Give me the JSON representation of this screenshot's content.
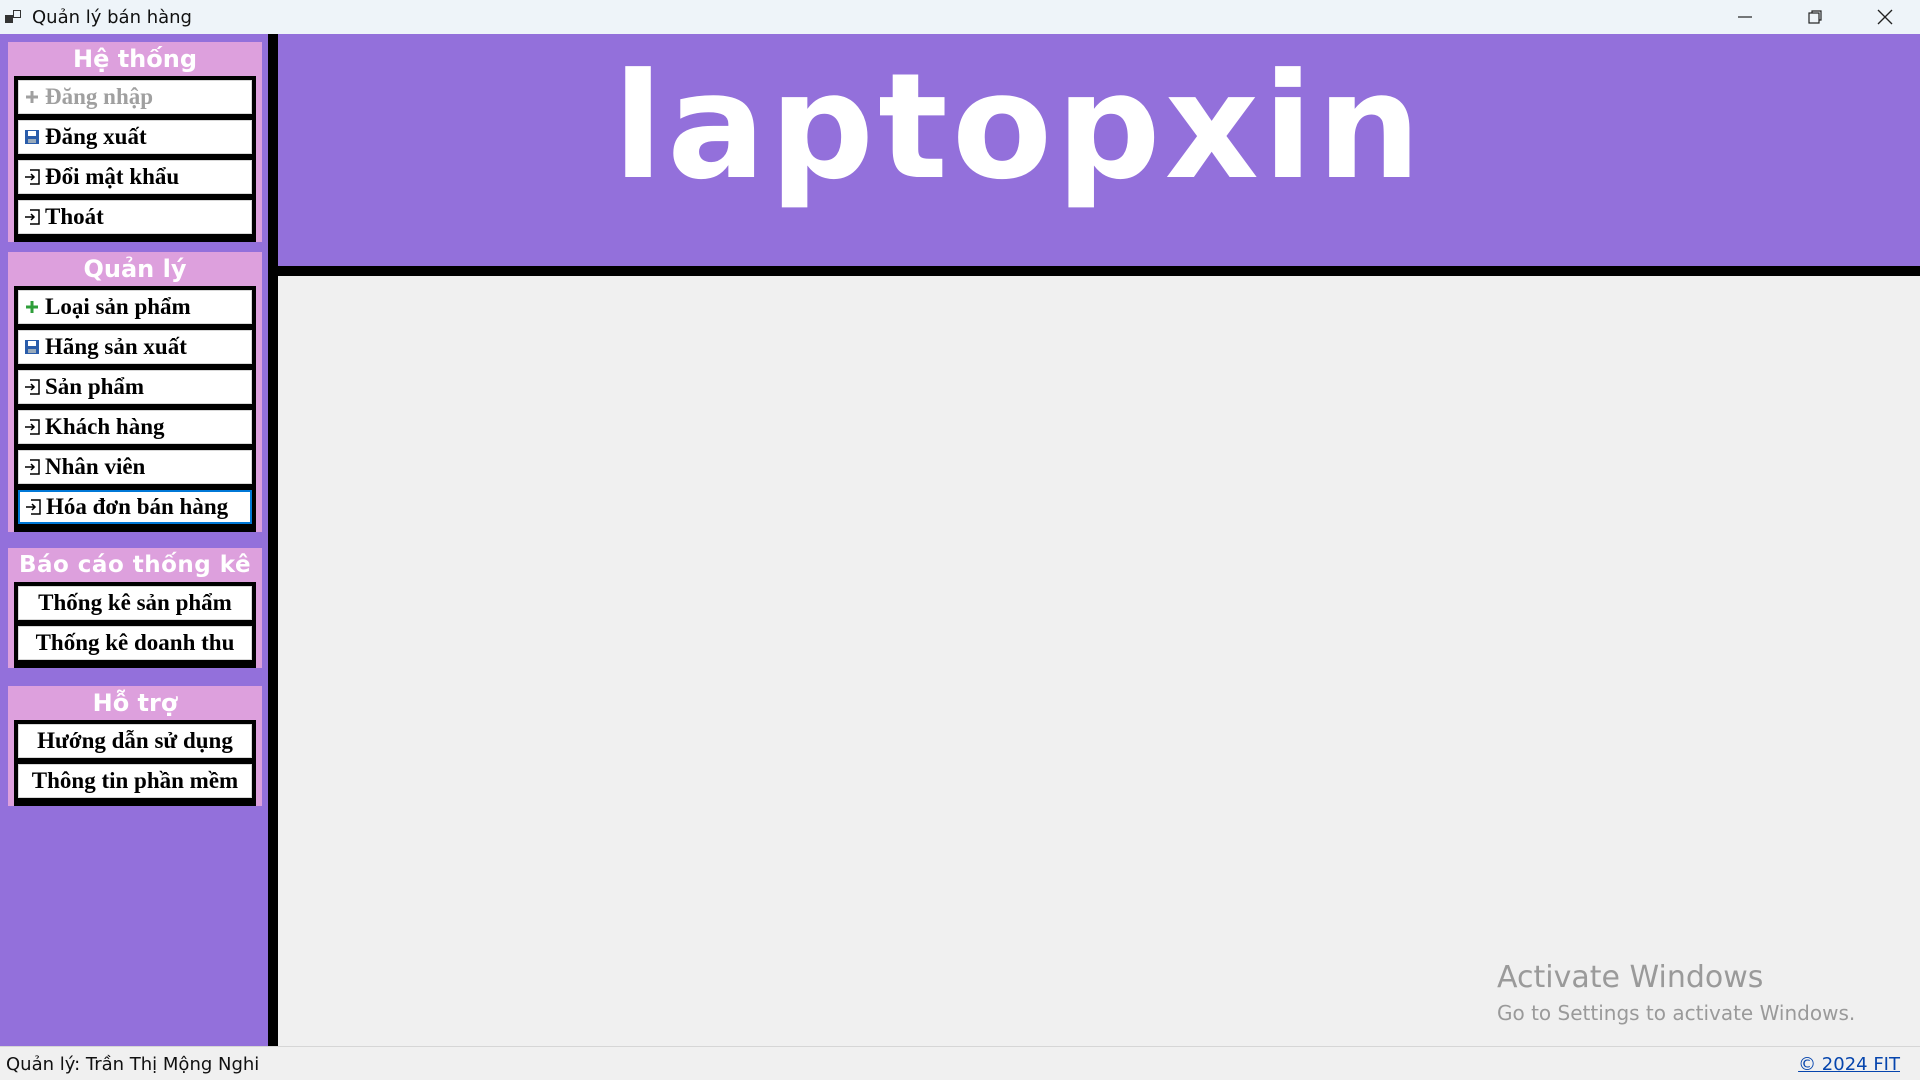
{
  "window": {
    "title": "Quản lý bán hàng"
  },
  "sidebar": {
    "he_thong": {
      "title": "Hệ thống",
      "items": [
        {
          "label": "Đăng nhập",
          "icon": "plus-icon"
        },
        {
          "label": "Đăng xuất",
          "icon": "save-icon"
        },
        {
          "label": "Đổi mật khẩu",
          "icon": "login-icon"
        },
        {
          "label": "Thoát",
          "icon": "login-icon"
        }
      ]
    },
    "quan_ly": {
      "title": "Quản lý",
      "items": [
        {
          "label": "Loại sản phẩm",
          "icon": "plus-icon"
        },
        {
          "label": "Hãng sản xuất",
          "icon": "save-icon"
        },
        {
          "label": "Sản phẩm",
          "icon": "login-icon"
        },
        {
          "label": "Khách hàng",
          "icon": "login-icon"
        },
        {
          "label": "Nhân viên",
          "icon": "login-icon"
        },
        {
          "label": "Hóa đơn bán hàng",
          "icon": "login-icon"
        }
      ]
    },
    "bao_cao": {
      "title": "Báo cáo thống kê",
      "items": [
        {
          "label": "Thống kê sản phẩm"
        },
        {
          "label": "Thống kê doanh thu"
        }
      ]
    },
    "ho_tro": {
      "title": "Hỗ trợ",
      "items": [
        {
          "label": "Hướng dẫn sử dụng"
        },
        {
          "label": "Thông tin phần mềm"
        }
      ]
    }
  },
  "header": {
    "logo_text": "laptopxin"
  },
  "watermark": {
    "line1": "Activate Windows",
    "line2": "Go to Settings to activate Windows."
  },
  "statusbar": {
    "manager": "Quản lý: Trần Thị Mộng Nghi",
    "copyright": "© 2024 FIT"
  },
  "colors": {
    "sidebar_bg": "#9370db",
    "group_bg": "#dda0dd",
    "header_bg": "#9370db",
    "divider": "#000000",
    "link": "#0645ad"
  }
}
